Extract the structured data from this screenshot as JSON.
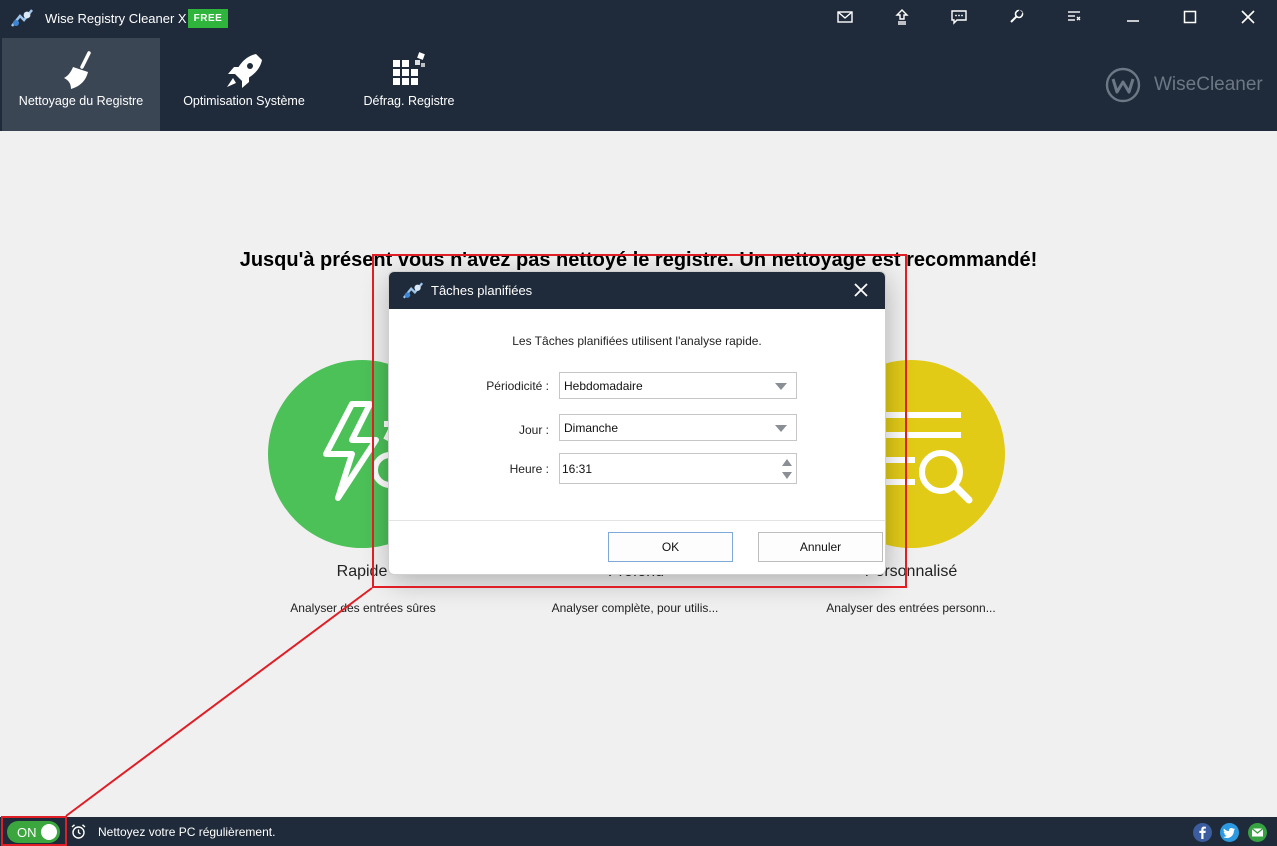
{
  "app": {
    "title": "Wise Registry Cleaner X",
    "badge": "FREE",
    "brand": "WiseCleaner"
  },
  "titlebar_icons": [
    "mail-icon",
    "upgrade-icon",
    "feedback-icon",
    "settings-icon",
    "menu-icon",
    "minimize-icon",
    "maximize-icon",
    "close-icon"
  ],
  "nav": {
    "tabs": [
      {
        "label": "Nettoyage du Registre",
        "icon": "broom-icon",
        "active": true
      },
      {
        "label": "Optimisation Système",
        "icon": "rocket-icon",
        "active": false
      },
      {
        "label": "Défrag. Registre",
        "icon": "defrag-blocks-icon",
        "active": false
      }
    ]
  },
  "main": {
    "headline": "Jusqu'à présent vous n'avez pas nettoyé le registre. Un nettoyage est recommandé!",
    "modes": [
      {
        "name": "Rapide",
        "desc": "Analyser des entrées sûres",
        "color": "#4cc158",
        "icon": "lightning-scan-icon"
      },
      {
        "name": "Profond",
        "desc": "Analyser complète, pour utilis...",
        "color": "#2ea7e0",
        "icon": "deep-scan-icon"
      },
      {
        "name": "Personnalisé",
        "desc": "Analyser des entrées personn...",
        "color": "#e2cb17",
        "icon": "custom-scan-icon"
      }
    ]
  },
  "dialog": {
    "title": "Tâches planifiées",
    "info": "Les Tâches planifiées utilisent l'analyse rapide.",
    "frequency_label": "Périodicité :",
    "frequency_value": "Hebdomadaire",
    "day_label": "Jour :",
    "day_value": "Dimanche",
    "time_label": "Heure :",
    "time_value": "16:31",
    "ok_label": "OK",
    "cancel_label": "Annuler"
  },
  "statusbar": {
    "toggle_label": "ON",
    "message": "Nettoyez votre PC régulièrement."
  },
  "colors": {
    "header_bg": "#1f2b3a",
    "active_tab_bg": "#3b4654",
    "badge_green": "#2fb53b",
    "annotation_red": "#e01e26"
  }
}
